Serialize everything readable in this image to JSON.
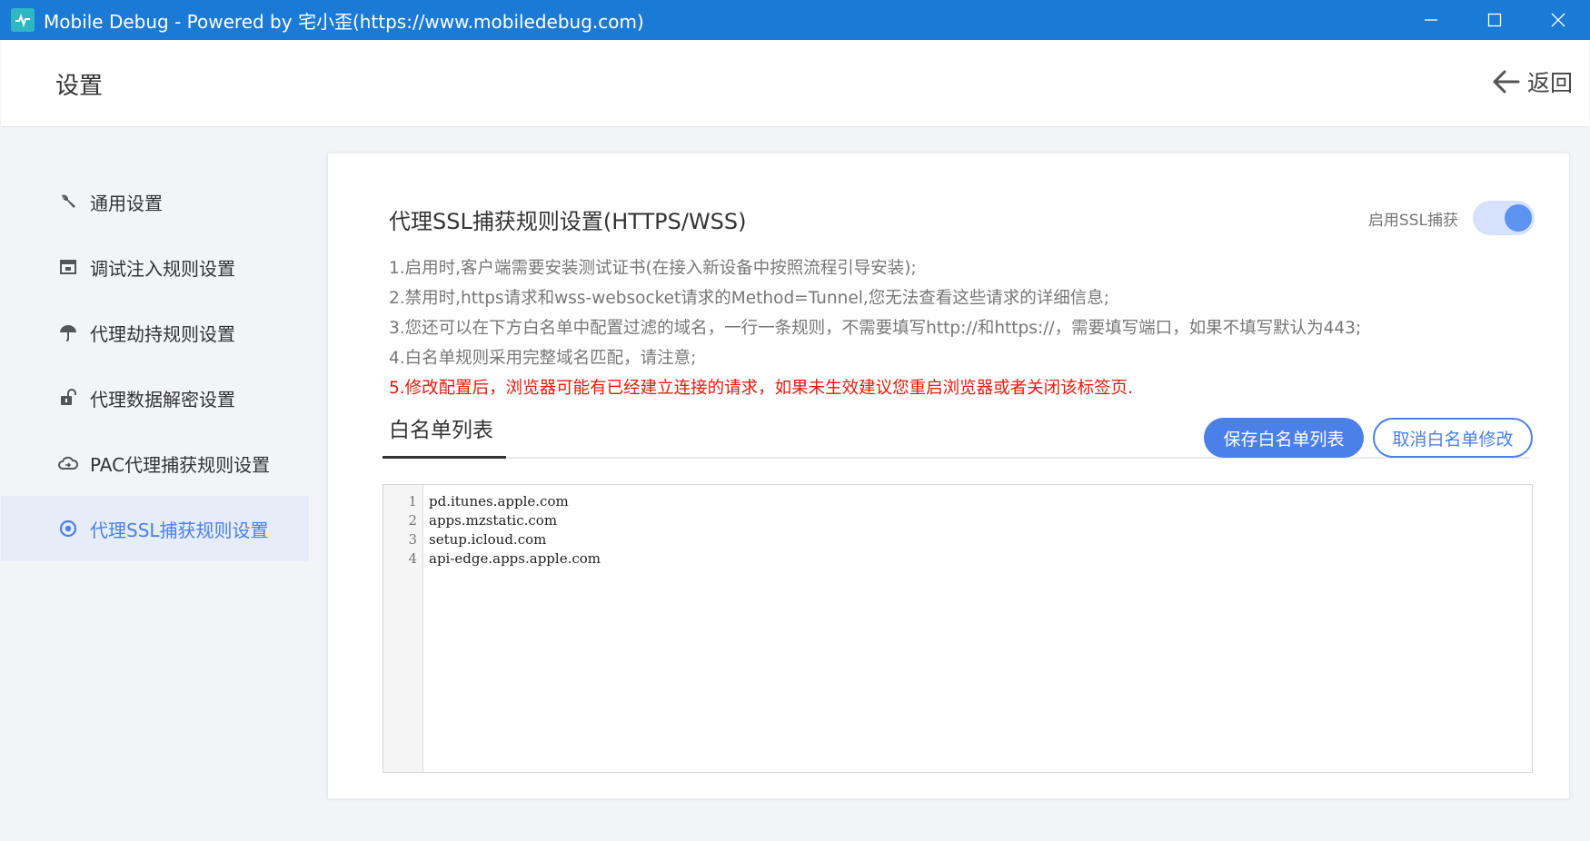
{
  "window": {
    "title": "Mobile Debug - Powered by 宅小歪(https://www.mobiledebug.com)",
    "logo_icon": "mobile-debug-logo",
    "controls": [
      "minimize-icon",
      "maximize-icon",
      "close-icon"
    ]
  },
  "header": {
    "title": "设置",
    "back_label": "返回"
  },
  "sidebar": {
    "items": [
      {
        "label": "通用设置",
        "icon": "wrench-icon"
      },
      {
        "label": "调试注入规则设置",
        "icon": "window-icon"
      },
      {
        "label": "代理劫持规则设置",
        "icon": "umbrella-icon"
      },
      {
        "label": "代理数据解密设置",
        "icon": "unlock-icon"
      },
      {
        "label": "PAC代理捕获规则设置",
        "icon": "cloud-icon"
      },
      {
        "label": "代理SSL捕获规则设置",
        "icon": "target-icon",
        "active": true
      }
    ]
  },
  "panel": {
    "title": "代理SSL捕获规则设置(HTTPS/WSS)",
    "ssl_toggle_label": "启用SSL捕获",
    "ssl_enabled": true,
    "notes": [
      "1.启用时,客户端需要安装测试证书(在接入新设备中按照流程引导安装);",
      "2.禁用时,https请求和wss-websocket请求的Method=Tunnel,您无法查看这些请求的详细信息;",
      "3.您还可以在下方白名单中配置过滤的域名，一行一条规则，不需要填写http://和https://，需要填写端口，如果不填写默认为443;",
      "4.白名单规则采用完整域名匹配，请注意;"
    ],
    "warning": "5.修改配置后，浏览器可能有已经建立连接的请求，如果未生效建议您重启浏览器或者关闭该标签页.",
    "tab_label": "白名单列表",
    "save_label": "保存白名单列表",
    "cancel_label": "取消白名单修改",
    "editor": {
      "line_numbers": [
        "1",
        "2",
        "3",
        "4"
      ],
      "lines": [
        "pd.itunes.apple.com",
        "apps.mzstatic.com",
        "setup.icloud.com",
        "api-edge.apps.apple.com"
      ]
    }
  },
  "colors": {
    "titlebar": "#1a7ad6",
    "accent": "#4a80e8",
    "warning": "#e8190b",
    "active_bg": "#e6ecf8"
  }
}
